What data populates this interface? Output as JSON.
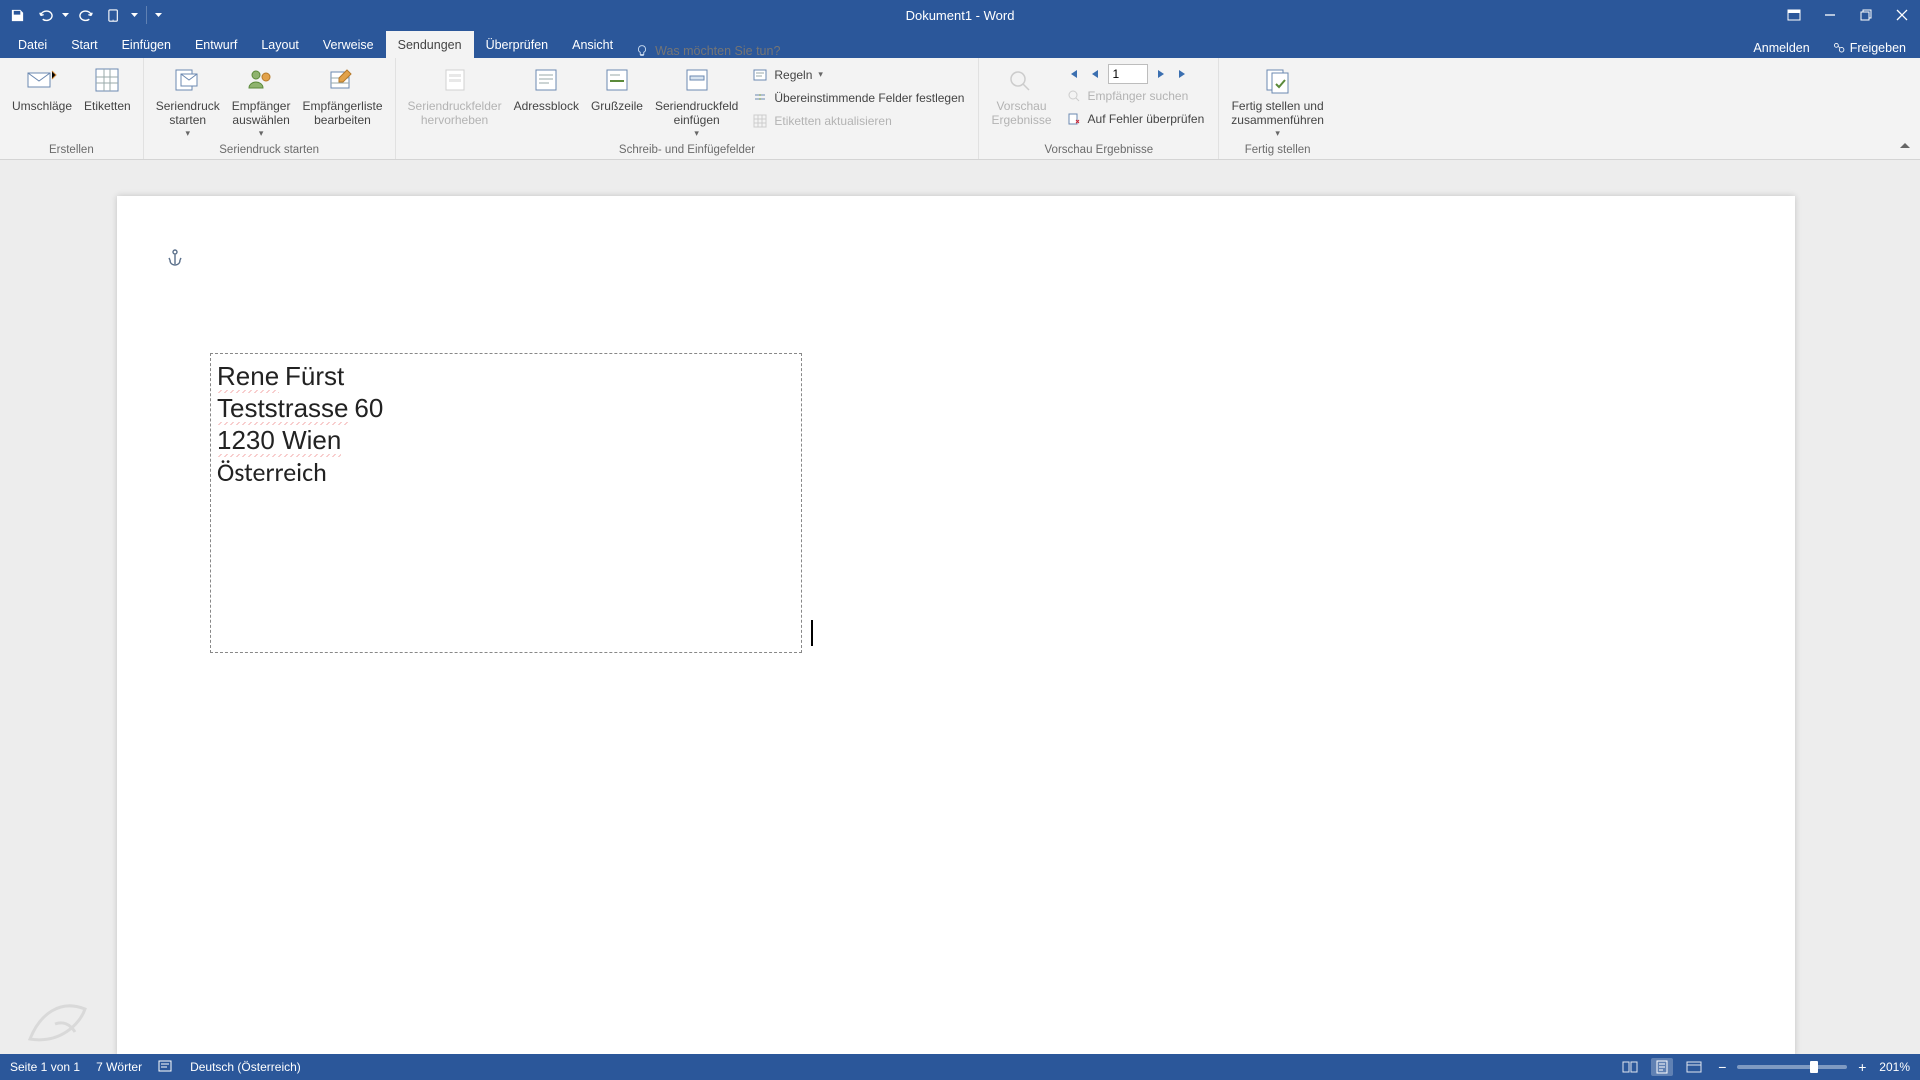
{
  "title": "Dokument1 - Word",
  "qat": {
    "save": "Speichern",
    "undo": "Rückgängig",
    "redo": "Wiederholen"
  },
  "tabs": {
    "file": "Datei",
    "home": "Start",
    "insert": "Einfügen",
    "design": "Entwurf",
    "layout": "Layout",
    "references": "Verweise",
    "mailings": "Sendungen",
    "review": "Überprüfen",
    "view": "Ansicht"
  },
  "search_placeholder": "Was möchten Sie tun?",
  "account": {
    "signin": "Anmelden",
    "share": "Freigeben"
  },
  "ribbon": {
    "group_create": "Erstellen",
    "group_start": "Seriendruck starten",
    "group_fields": "Schreib- und Einfügefelder",
    "group_preview": "Vorschau Ergebnisse",
    "group_finish": "Fertig stellen",
    "envelopes": "Umschläge",
    "labels": "Etiketten",
    "start_merge": "Seriendruck\nstarten",
    "select_recipients": "Empfänger\nauswählen",
    "edit_recipients": "Empfängerliste\nbearbeiten",
    "highlight_fields": "Seriendruckfelder\nhervorheben",
    "address_block": "Adressblock",
    "greeting_line": "Grußzeile",
    "insert_merge_field": "Seriendruckfeld\neinfügen",
    "rules": "Regeln",
    "match_fields": "Übereinstimmende Felder festlegen",
    "update_labels": "Etiketten aktualisieren",
    "preview_results": "Vorschau\nErgebnisse",
    "record_number": "1",
    "find_recipient": "Empfänger suchen",
    "check_errors": "Auf Fehler überprüfen",
    "finish_merge": "Fertig stellen und\nzusammenführen"
  },
  "document": {
    "line1_a": "Rene",
    "line1_b": "Fürst",
    "line2_a": "Teststrasse",
    "line2_b": "60",
    "line3": "1230 Wien",
    "line4": "Österreich"
  },
  "status": {
    "page": "Seite 1 von 1",
    "words": "7 Wörter",
    "language": "Deutsch (Österreich)",
    "zoom": "201%"
  }
}
